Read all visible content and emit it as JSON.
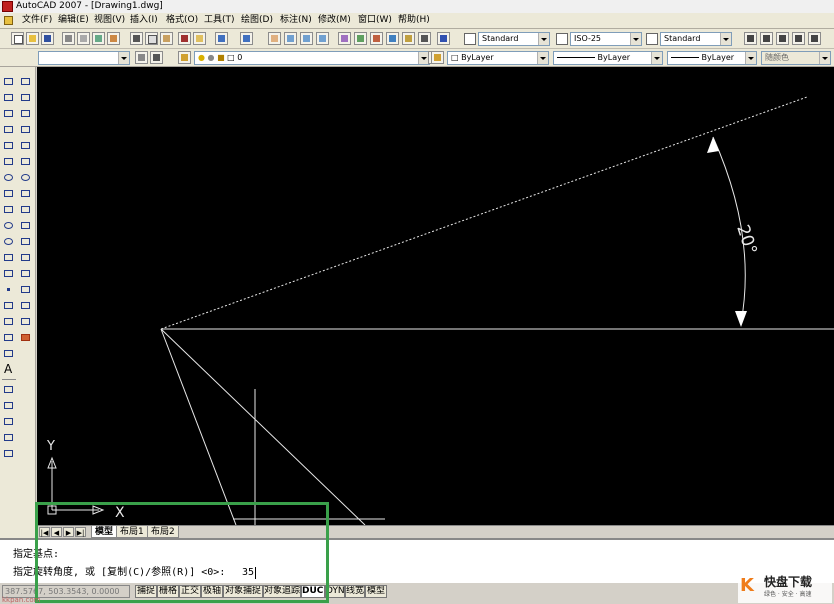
{
  "window": {
    "title": "AutoCAD 2007 - [Drawing1.dwg]",
    "app_icon": "autocad-app-icon"
  },
  "menu": [
    "文件(F)",
    "编辑(E)",
    "视图(V)",
    "插入(I)",
    "格式(O)",
    "工具(T)",
    "绘图(D)",
    "标注(N)",
    "修改(M)",
    "窗口(W)",
    "帮助(H)"
  ],
  "toolbar": {
    "text_style": "Standard",
    "dim_style": "ISO-25",
    "table_style": "Standard",
    "layer": "0",
    "color": "ByLayer",
    "linetype": "ByLayer",
    "lineweight": "ByLayer",
    "plot_style": "随颜色"
  },
  "left_tools": {
    "text_tool": "A"
  },
  "canvas": {
    "background": "#000000",
    "angle_label": "20°",
    "ucs_x": "X",
    "ucs_y": "Y"
  },
  "layout_tabs": {
    "nav": [
      "|◀",
      "◀",
      "▶",
      "▶|"
    ],
    "tabs": [
      "模型",
      "布局1",
      "布局2"
    ],
    "active": "模型"
  },
  "command": {
    "line1": "指定基点:",
    "line2": "指定旋转角度, 或 [复制(C)/参照(R)] <0>:",
    "input": "35"
  },
  "status": {
    "coords": "387.5767, 503.3543, 0.0000",
    "buttons": [
      "捕捉",
      "栅格",
      "正交",
      "极轴",
      "对象捕捉",
      "对象追踪",
      "DUCS",
      "DYN",
      "线宽",
      "模型"
    ],
    "on": [
      "DUCS"
    ]
  },
  "watermark": {
    "mark": "K",
    "name": "快盘下载",
    "sub": "绿色 · 安全 · 高速"
  },
  "source_url": "kkpan.com",
  "colors": {
    "highlight_box": "#3aa04a",
    "watermark": "#ef7c1a"
  }
}
